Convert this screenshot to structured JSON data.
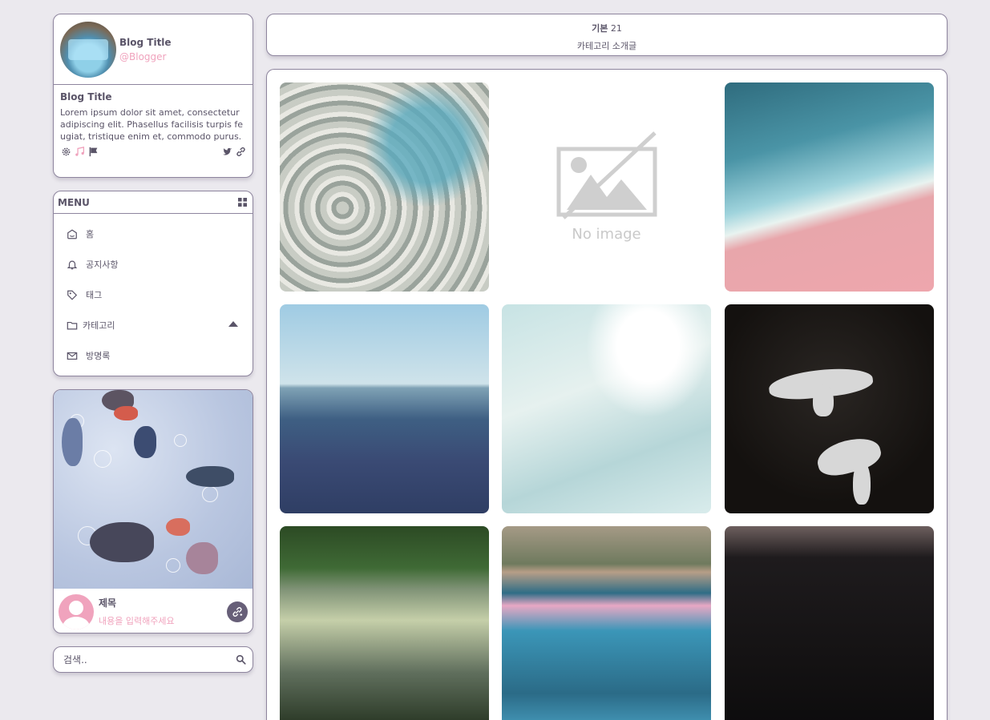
{
  "profile": {
    "blog_title": "Blog Title",
    "handle": "@Blogger",
    "title": "Blog Title",
    "description": "Lorem ipsum dolor sit amet, consectetur adipiscing elit. Phasellus facilisis turpis feugiat, tristique enim et, commodo purus.",
    "icons_left": [
      "gear-icon",
      "music-icon",
      "flag-icon"
    ],
    "icons_right": [
      "twitter-icon",
      "link-icon"
    ]
  },
  "menu": {
    "header": "MENU",
    "items": [
      {
        "label": "홈",
        "icon": "home-icon"
      },
      {
        "label": "공지사항",
        "icon": "bell-icon"
      },
      {
        "label": "태그",
        "icon": "tag-icon"
      },
      {
        "label": "카테고리",
        "icon": "folder-icon"
      },
      {
        "label": "방명록",
        "icon": "mail-icon"
      }
    ]
  },
  "feature": {
    "title": "제목",
    "subtitle": "내용을 입력해주세요"
  },
  "search": {
    "placeholder": "검색.."
  },
  "header": {
    "category": "기본",
    "count": "21",
    "subtitle": "카테고리 소개글"
  },
  "gallery": {
    "no_image_text": "No image"
  },
  "colors": {
    "accent_pink": "#f0a3bd",
    "text": "#5a5468",
    "border": "#8e859e",
    "background": "#ebe9ee"
  }
}
